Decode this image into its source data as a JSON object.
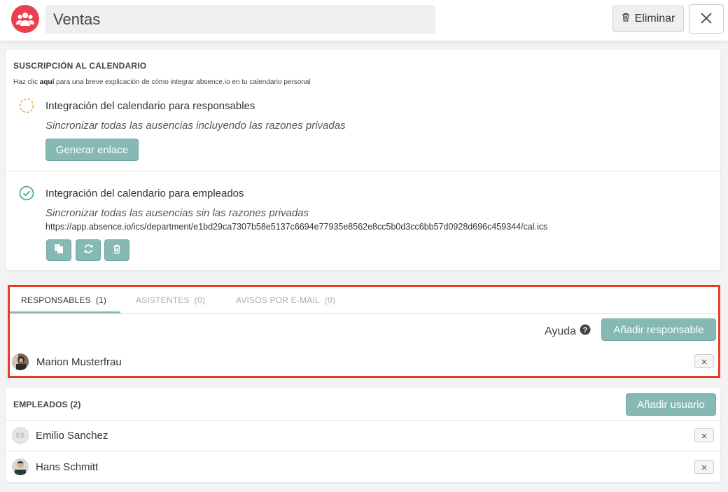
{
  "header": {
    "title": "Ventas",
    "delete_label": "Eliminar"
  },
  "calendar": {
    "section_title": "SUSCRIPCIÓN AL CALENDARIO",
    "hint_prefix": "Haz clic ",
    "hint_link": "aquí",
    "hint_suffix": " para una breve explicación de cómo integrar absence.io en tu calendario personal",
    "managers": {
      "title": "Integración del calendario para responsables",
      "subtitle": "Sincronizar todas las ausencias incluyendo las razones privadas",
      "button_label": "Generar enlace"
    },
    "employees": {
      "title": "Integración del calendario para empleados",
      "subtitle": "Sincronizar todas las ausencias sin las razones privadas",
      "url": "https://app.absence.io/ics/department/e1bd29ca7307b58e5137c6694e77935e8562e8cc5b0d3cc6bb57d0928d696c459344/cal.ics"
    }
  },
  "tabs": [
    {
      "label": "RESPONSABLES",
      "count": "(1)",
      "active": true
    },
    {
      "label": "ASISTENTES",
      "count": "(0)",
      "active": false
    },
    {
      "label": "AVISOS POR E-MAIL",
      "count": "(0)",
      "active": false
    }
  ],
  "managers_panel": {
    "help_label": "Ayuda",
    "add_label": "Añadir responsable",
    "people": [
      {
        "name": "Marion Musterfrau"
      }
    ]
  },
  "employees_section": {
    "title": "EMPLEADOS (2)",
    "add_label": "Añadir usuario",
    "people": [
      {
        "name": "Emilio Sanchez",
        "initials": "ES"
      },
      {
        "name": "Hans Schmitt"
      }
    ]
  },
  "colors": {
    "accent": "#86b9b6",
    "brand_red": "#e8404f",
    "highlight": "#ec3a25",
    "pending_orange": "#e9a23b",
    "ok_green": "#3aa77a"
  }
}
